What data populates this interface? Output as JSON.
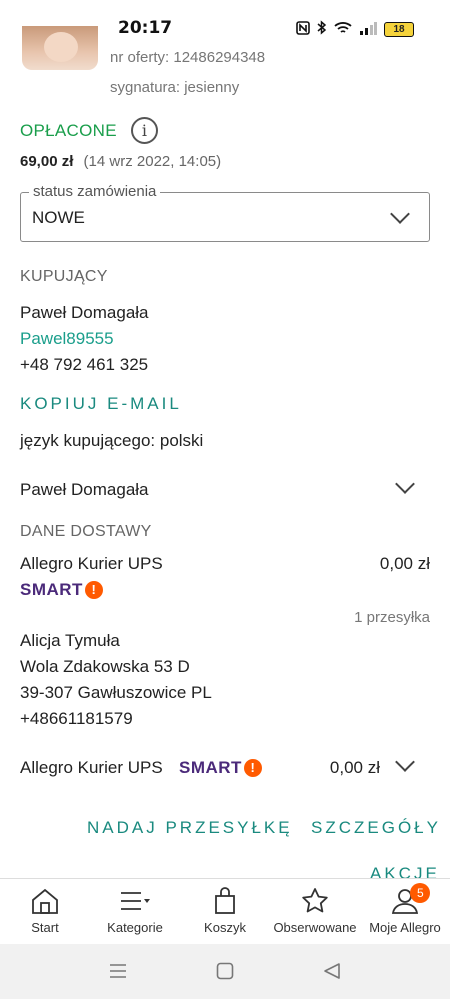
{
  "status_bar": {
    "time": "20:17",
    "icons": [
      "nfc-icon",
      "bluetooth-icon",
      "wifi-icon",
      "signal-icon"
    ],
    "battery": "18"
  },
  "offer": {
    "offer_number": "nr oferty: 12486294348",
    "signature": "sygnatura: jesienny"
  },
  "payment": {
    "status": "OPŁACONE",
    "status_color": "#1a9e4b",
    "info_glyph": "i",
    "amount": "69,00 zł",
    "date": "(14 wrz 2022, 14:05)"
  },
  "order_status": {
    "legend": "status zamówienia",
    "value": "NOWE"
  },
  "buyer": {
    "section_title": "KUPUJĄCY",
    "name": "Paweł Domagała",
    "login": "Pawel89555",
    "phone": "+48 792 461 325",
    "copy_email": "KOPIUJ E-MAIL",
    "language": "język kupującego: polski",
    "collapsed_name": "Paweł Domagała"
  },
  "delivery": {
    "section_title": "DANE DOSTAWY",
    "method": "Allegro Kurier UPS",
    "price": "0,00 zł",
    "smart_label": "SMART",
    "smart_bang": "!",
    "shipments": "1 przesyłka",
    "recipient": {
      "name": "Alicja Tymuła",
      "street": "Wola Zdakowska 53 D",
      "city": "39-307 Gawłuszowice PL",
      "phone": "+48661181579"
    },
    "package": {
      "method": "Allegro Kurier UPS",
      "smart_label": "SMART",
      "smart_bang": "!",
      "price": "0,00 zł"
    }
  },
  "actions": {
    "send": "NADAJ PRZESYŁKĘ",
    "details": "SZCZEGÓŁY",
    "more": "AKCJE"
  },
  "bottom_nav": {
    "items": [
      {
        "label": "Start",
        "icon": "home-icon"
      },
      {
        "label": "Kategorie",
        "icon": "menu-icon"
      },
      {
        "label": "Koszyk",
        "icon": "bag-icon"
      },
      {
        "label": "Obserwowane",
        "icon": "star-icon"
      },
      {
        "label": "Moje Allegro",
        "icon": "user-icon",
        "badge": "5"
      }
    ]
  },
  "colors": {
    "accent_teal": "#1a8a7f",
    "smart_purple": "#4b2a7a",
    "badge_orange": "#ff5a00"
  }
}
